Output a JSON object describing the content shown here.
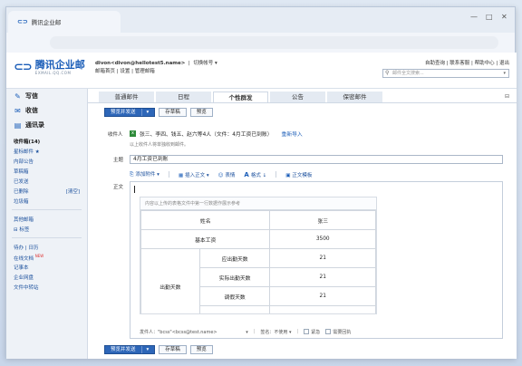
{
  "browser": {
    "tab_title": "腾讯企业邮",
    "window_controls": [
      "—",
      "□",
      "✕"
    ]
  },
  "header": {
    "brand_name": "腾讯企业邮",
    "brand_sub": "EXMAIL.QQ.COM",
    "user": "divon<divon@hellotest5.name>",
    "switch_account": "切换帐号 ▾",
    "user_links": "邮箱首页 | 设置 | 管理邮箱",
    "top_links": "自助查询 | 联系客服 | 帮助中心 | 退出",
    "search_placeholder": "邮件全文搜索..."
  },
  "sidebar": {
    "compose": "写信",
    "receive": "收信",
    "contacts": "通讯录",
    "folders": [
      {
        "label": "收件箱(14)",
        "bold": true,
        "extra": ""
      },
      {
        "label": "星标邮件 ★",
        "bold": false,
        "extra": ""
      },
      {
        "label": "内部公告",
        "bold": false,
        "extra": ""
      },
      {
        "label": "草稿箱",
        "bold": false,
        "extra": ""
      },
      {
        "label": "已发送",
        "bold": false,
        "extra": ""
      },
      {
        "label": "已删除",
        "bold": false,
        "extra": "[清空]"
      },
      {
        "label": "垃圾箱",
        "bold": false,
        "extra": ""
      }
    ],
    "other_folders": "其他邮箱",
    "tags": "⊟ 标签",
    "tools": [
      {
        "label": "待办 | 日历"
      },
      {
        "label": "在线文档"
      },
      {
        "label": "记事本"
      },
      {
        "label": "企业网盘"
      },
      {
        "label": "文件中转站"
      }
    ],
    "new_badge": "NEW"
  },
  "main": {
    "tabs": [
      "普通邮件",
      "日程",
      "个性群发",
      "公告",
      "保密邮件"
    ],
    "active_tab": "个性群发",
    "send_button": "预览并发送",
    "send_dropdown": "▾",
    "save_draft": "存草稿",
    "preview": "预览",
    "recipients_label": "收件人",
    "recipients_value": "张三、李四、钱五、赵六等4人（文件：4月工资已到账）",
    "reimport": "重新导入",
    "recipient_note": "以上收件人将单独收到邮件。",
    "subject_label": "主题",
    "subject_value": "4月工资已到账",
    "editbar": {
      "attach": "添加附件",
      "insert_text": "插入正文",
      "emoji": "表情",
      "format": "格式",
      "template": "正文模板"
    },
    "body_label": "正文",
    "content_hint": "内容以上传的表格文件中第一行数据作展示参考",
    "salary_table": {
      "name_label": "姓名",
      "name_value": "张三",
      "base_label": "基本工资",
      "base_value": "3500",
      "attendance_group": "出勤天数",
      "should_label": "应出勤天数",
      "should_value": "21",
      "actual_label": "实际出勤天数",
      "actual_value": "21",
      "leave_label": "调假天数",
      "leave_value": "21"
    },
    "footer": {
      "sender": "发件人：\"bcss\"<bcss@test.name>",
      "sender_drop": "▾",
      "signature": "签名：不使用 ▾",
      "urgent": "紧急",
      "receipt": "需要回执"
    }
  }
}
